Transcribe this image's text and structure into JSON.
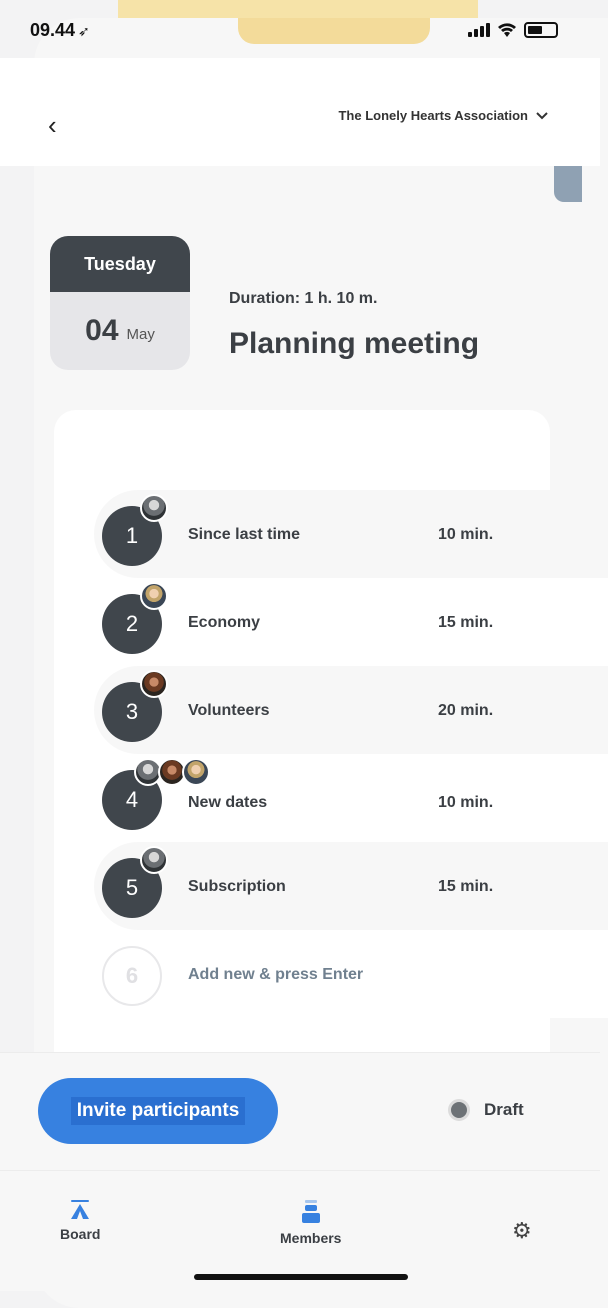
{
  "status_bar": {
    "time": "09.44"
  },
  "header": {
    "organization": "The Lonely Hearts Association"
  },
  "meeting": {
    "day": "Tuesday",
    "date_num": "04",
    "month": "May",
    "duration": "Duration: 1 h. 10 m.",
    "title": "Planning meeting"
  },
  "agenda": [
    {
      "number": "1",
      "title": "Since last time",
      "duration": "10 min."
    },
    {
      "number": "2",
      "title": "Economy",
      "duration": "15 min."
    },
    {
      "number": "3",
      "title": "Volunteers",
      "duration": "20 min."
    },
    {
      "number": "4",
      "title": "New dates",
      "duration": "10 min."
    },
    {
      "number": "5",
      "title": "Subscription",
      "duration": "15 min."
    }
  ],
  "new_item": {
    "number": "6",
    "placeholder": "Add new & press Enter"
  },
  "actions": {
    "invite_label": "Invite participants",
    "status_label": "Draft"
  },
  "tabs": {
    "board": "Board",
    "members": "Members"
  },
  "colors": {
    "accent": "#3781e0",
    "dark": "#40464c"
  }
}
